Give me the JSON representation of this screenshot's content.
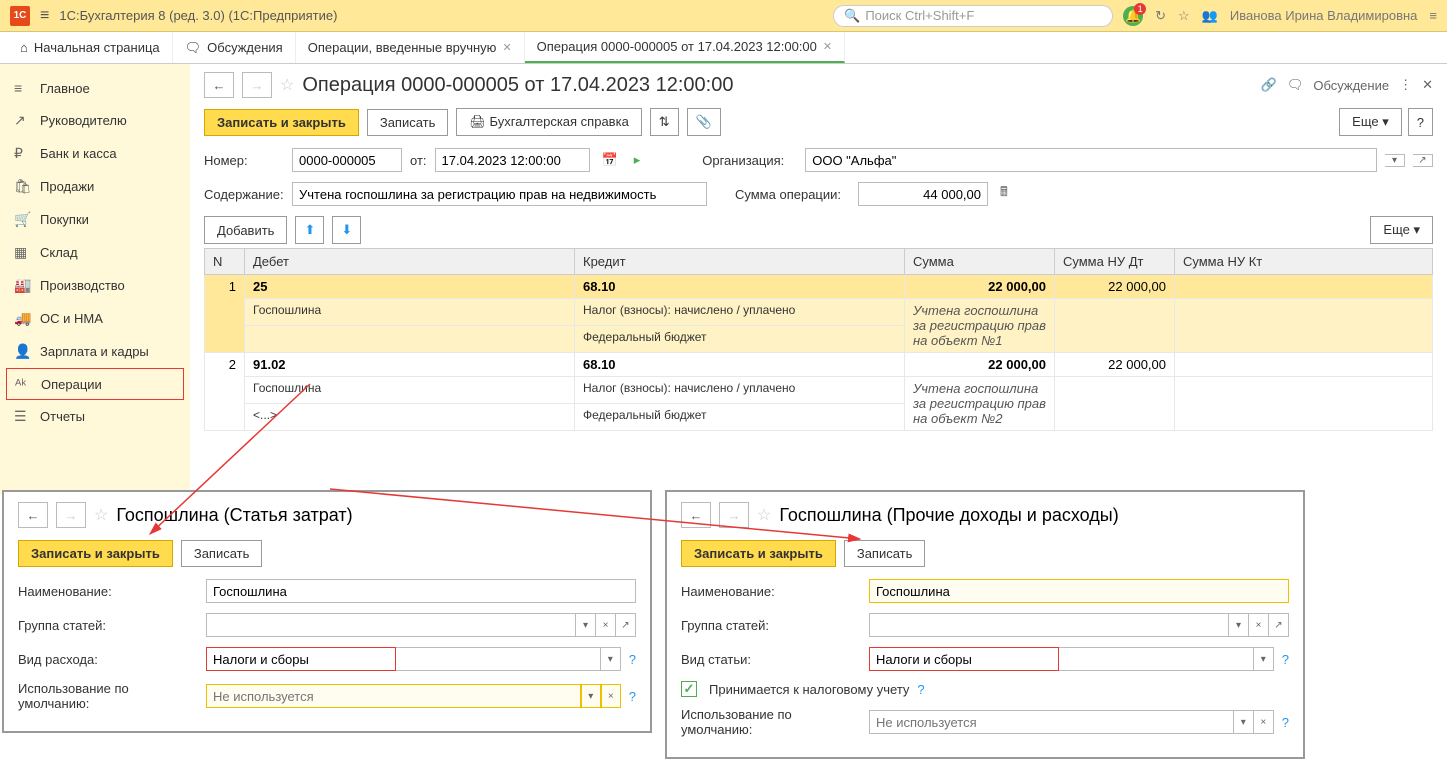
{
  "top": {
    "logo": "1C",
    "title": "1С:Бухгалтерия 8 (ред. 3.0)  (1С:Предприятие)",
    "search_placeholder": "Поиск Ctrl+Shift+F",
    "bell_count": "1",
    "user": "Иванова Ирина Владимировна"
  },
  "tabs": [
    {
      "label": "Начальная страница",
      "icon": "⌂"
    },
    {
      "label": "Обсуждения",
      "icon": "🗨"
    },
    {
      "label": "Операции, введенные вручную",
      "close": true
    },
    {
      "label": "Операция 0000-000005 от 17.04.2023 12:00:00",
      "close": true,
      "active": true
    }
  ],
  "nav": [
    {
      "ico": "≡",
      "label": "Главное"
    },
    {
      "ico": "↗",
      "label": "Руководителю"
    },
    {
      "ico": "₽",
      "label": "Банк и касса"
    },
    {
      "ico": "🛍",
      "label": "Продажи"
    },
    {
      "ico": "🛒",
      "label": "Покупки"
    },
    {
      "ico": "▦",
      "label": "Склад"
    },
    {
      "ico": "🏭",
      "label": "Производство"
    },
    {
      "ico": "🚚",
      "label": "ОС и НМА"
    },
    {
      "ico": "👤",
      "label": "Зарплата и кадры"
    },
    {
      "ico": "ᴬᵏ",
      "label": "Операции",
      "sel": true
    },
    {
      "ico": "☰",
      "label": "Отчеты"
    }
  ],
  "page": {
    "title": "Операция 0000-000005 от 17.04.2023 12:00:00",
    "discuss": "Обсуждение",
    "save_close": "Записать и закрыть",
    "save": "Записать",
    "acct_ref": "Бухгалтерская справка",
    "more": "Еще",
    "num_label": "Номер:",
    "num": "0000-000005",
    "from_label": "от:",
    "date": "17.04.2023 12:00:00",
    "org_label": "Организация:",
    "org": "ООО \"Альфа\"",
    "content_label": "Содержание:",
    "content": "Учтена госпошлина за регистрацию прав на недвижимость",
    "sum_label": "Сумма операции:",
    "sum": "44 000,00",
    "add": "Добавить"
  },
  "cols": {
    "n": "N",
    "debit": "Дебет",
    "credit": "Кредит",
    "sum": "Сумма",
    "sum_nu_dt": "Сумма НУ Дт",
    "sum_nu_kt": "Сумма НУ Кт"
  },
  "rows": [
    {
      "n": "1",
      "d_acc": "25",
      "d_sub1": "Госпошлина",
      "c_acc": "68.10",
      "c_sub1": "Налог (взносы): начислено / уплачено",
      "c_sub2": "Федеральный бюджет",
      "sum": "22 000,00",
      "sum_nu_dt": "22 000,00",
      "desc": "Учтена госпошлина за регистрацию прав на объект №1",
      "hl": true
    },
    {
      "n": "2",
      "d_acc": "91.02",
      "d_sub1": "Госпошлина",
      "d_sub2": "<...>",
      "c_acc": "68.10",
      "c_sub1": "Налог (взносы): начислено / уплачено",
      "c_sub2": "Федеральный бюджет",
      "sum": "22 000,00",
      "sum_nu_dt": "22 000,00",
      "desc": "Учтена госпошлина за регистрацию прав на объект №2"
    }
  ],
  "pop1": {
    "title": "Госпошлина (Статья затрат)",
    "save_close": "Записать и закрыть",
    "save": "Записать",
    "name_label": "Наименование:",
    "name": "Госпошлина",
    "group_label": "Группа статей:",
    "group": "",
    "type_label": "Вид расхода:",
    "type": "Налоги и сборы",
    "default_label": "Использование по умолчанию:",
    "default_ph": "Не используется"
  },
  "pop2": {
    "title": "Госпошлина (Прочие доходы и расходы)",
    "save_close": "Записать и закрыть",
    "save": "Записать",
    "name_label": "Наименование:",
    "name": "Госпошлина",
    "group_label": "Группа статей:",
    "group": "",
    "type_label": "Вид статьи:",
    "type": "Налоги и сборы",
    "tax_label": "Принимается к налоговому учету",
    "default_label": "Использование по умолчанию:",
    "default_ph": "Не используется"
  }
}
